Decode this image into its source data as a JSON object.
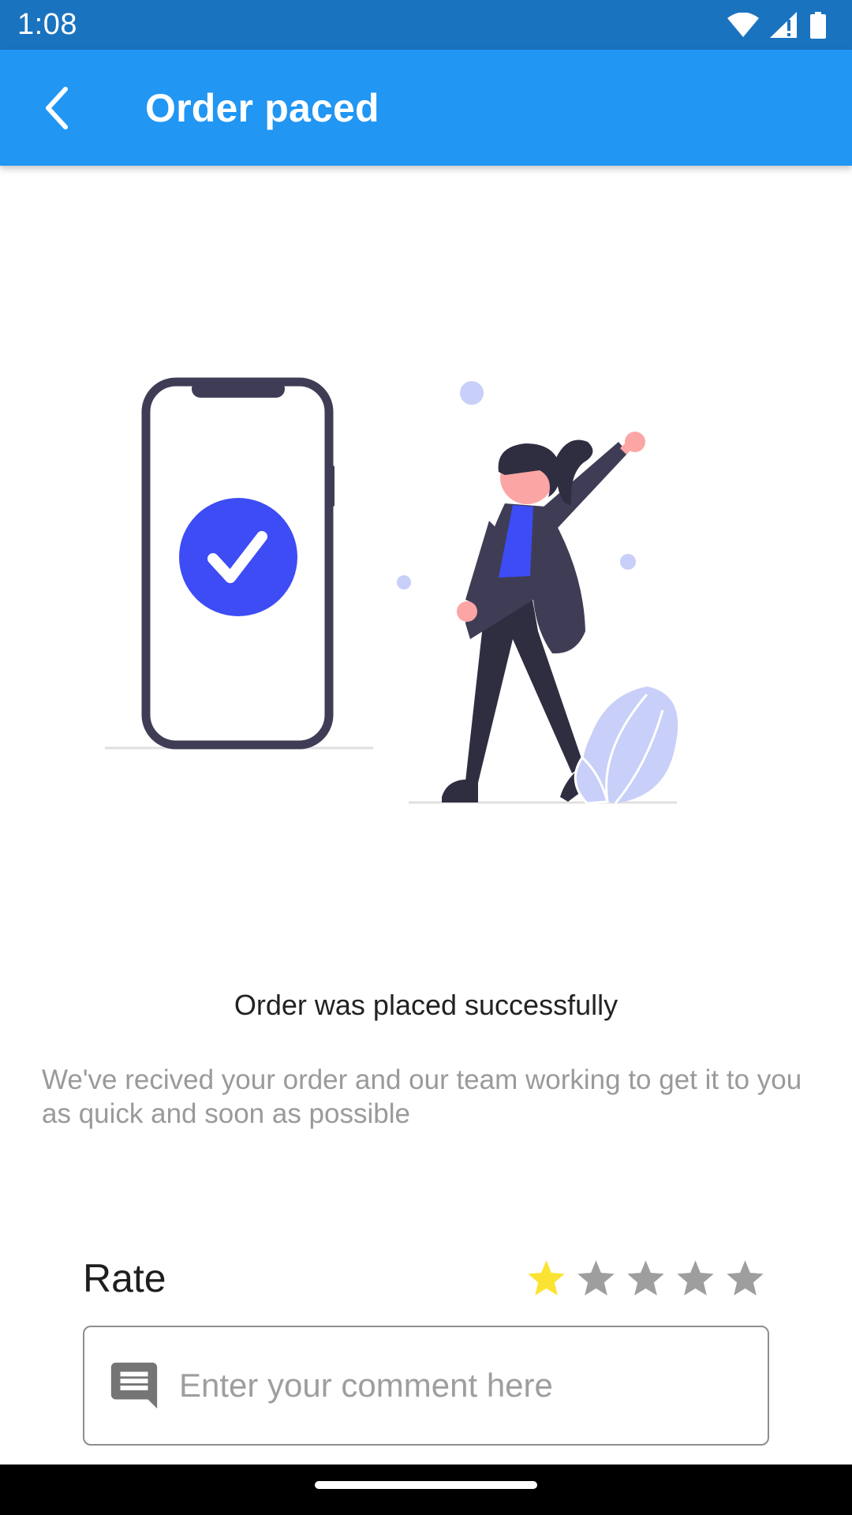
{
  "status_bar": {
    "time": "1:08",
    "icons": [
      "wifi-icon",
      "signal-icon",
      "battery-icon"
    ]
  },
  "app_bar": {
    "title": "Order paced",
    "back_icon": "chevron-left-icon",
    "color": "#2196f3"
  },
  "illustration": {
    "description_icons": [
      "phone-icon",
      "check-circle-icon",
      "person-icon",
      "leaf-icon"
    ],
    "accent_color": "#3f51f6"
  },
  "message": {
    "title": "Order was placed successfully",
    "description": "We've recived your order and our team working to get it to you as quick and soon as possible"
  },
  "rating": {
    "label": "Rate",
    "value": 1,
    "max": 5,
    "filled_color": "#fbe333",
    "empty_color": "#9e9e9e"
  },
  "comment": {
    "placeholder": "Enter your comment here",
    "value": "",
    "icon": "comment-icon"
  }
}
